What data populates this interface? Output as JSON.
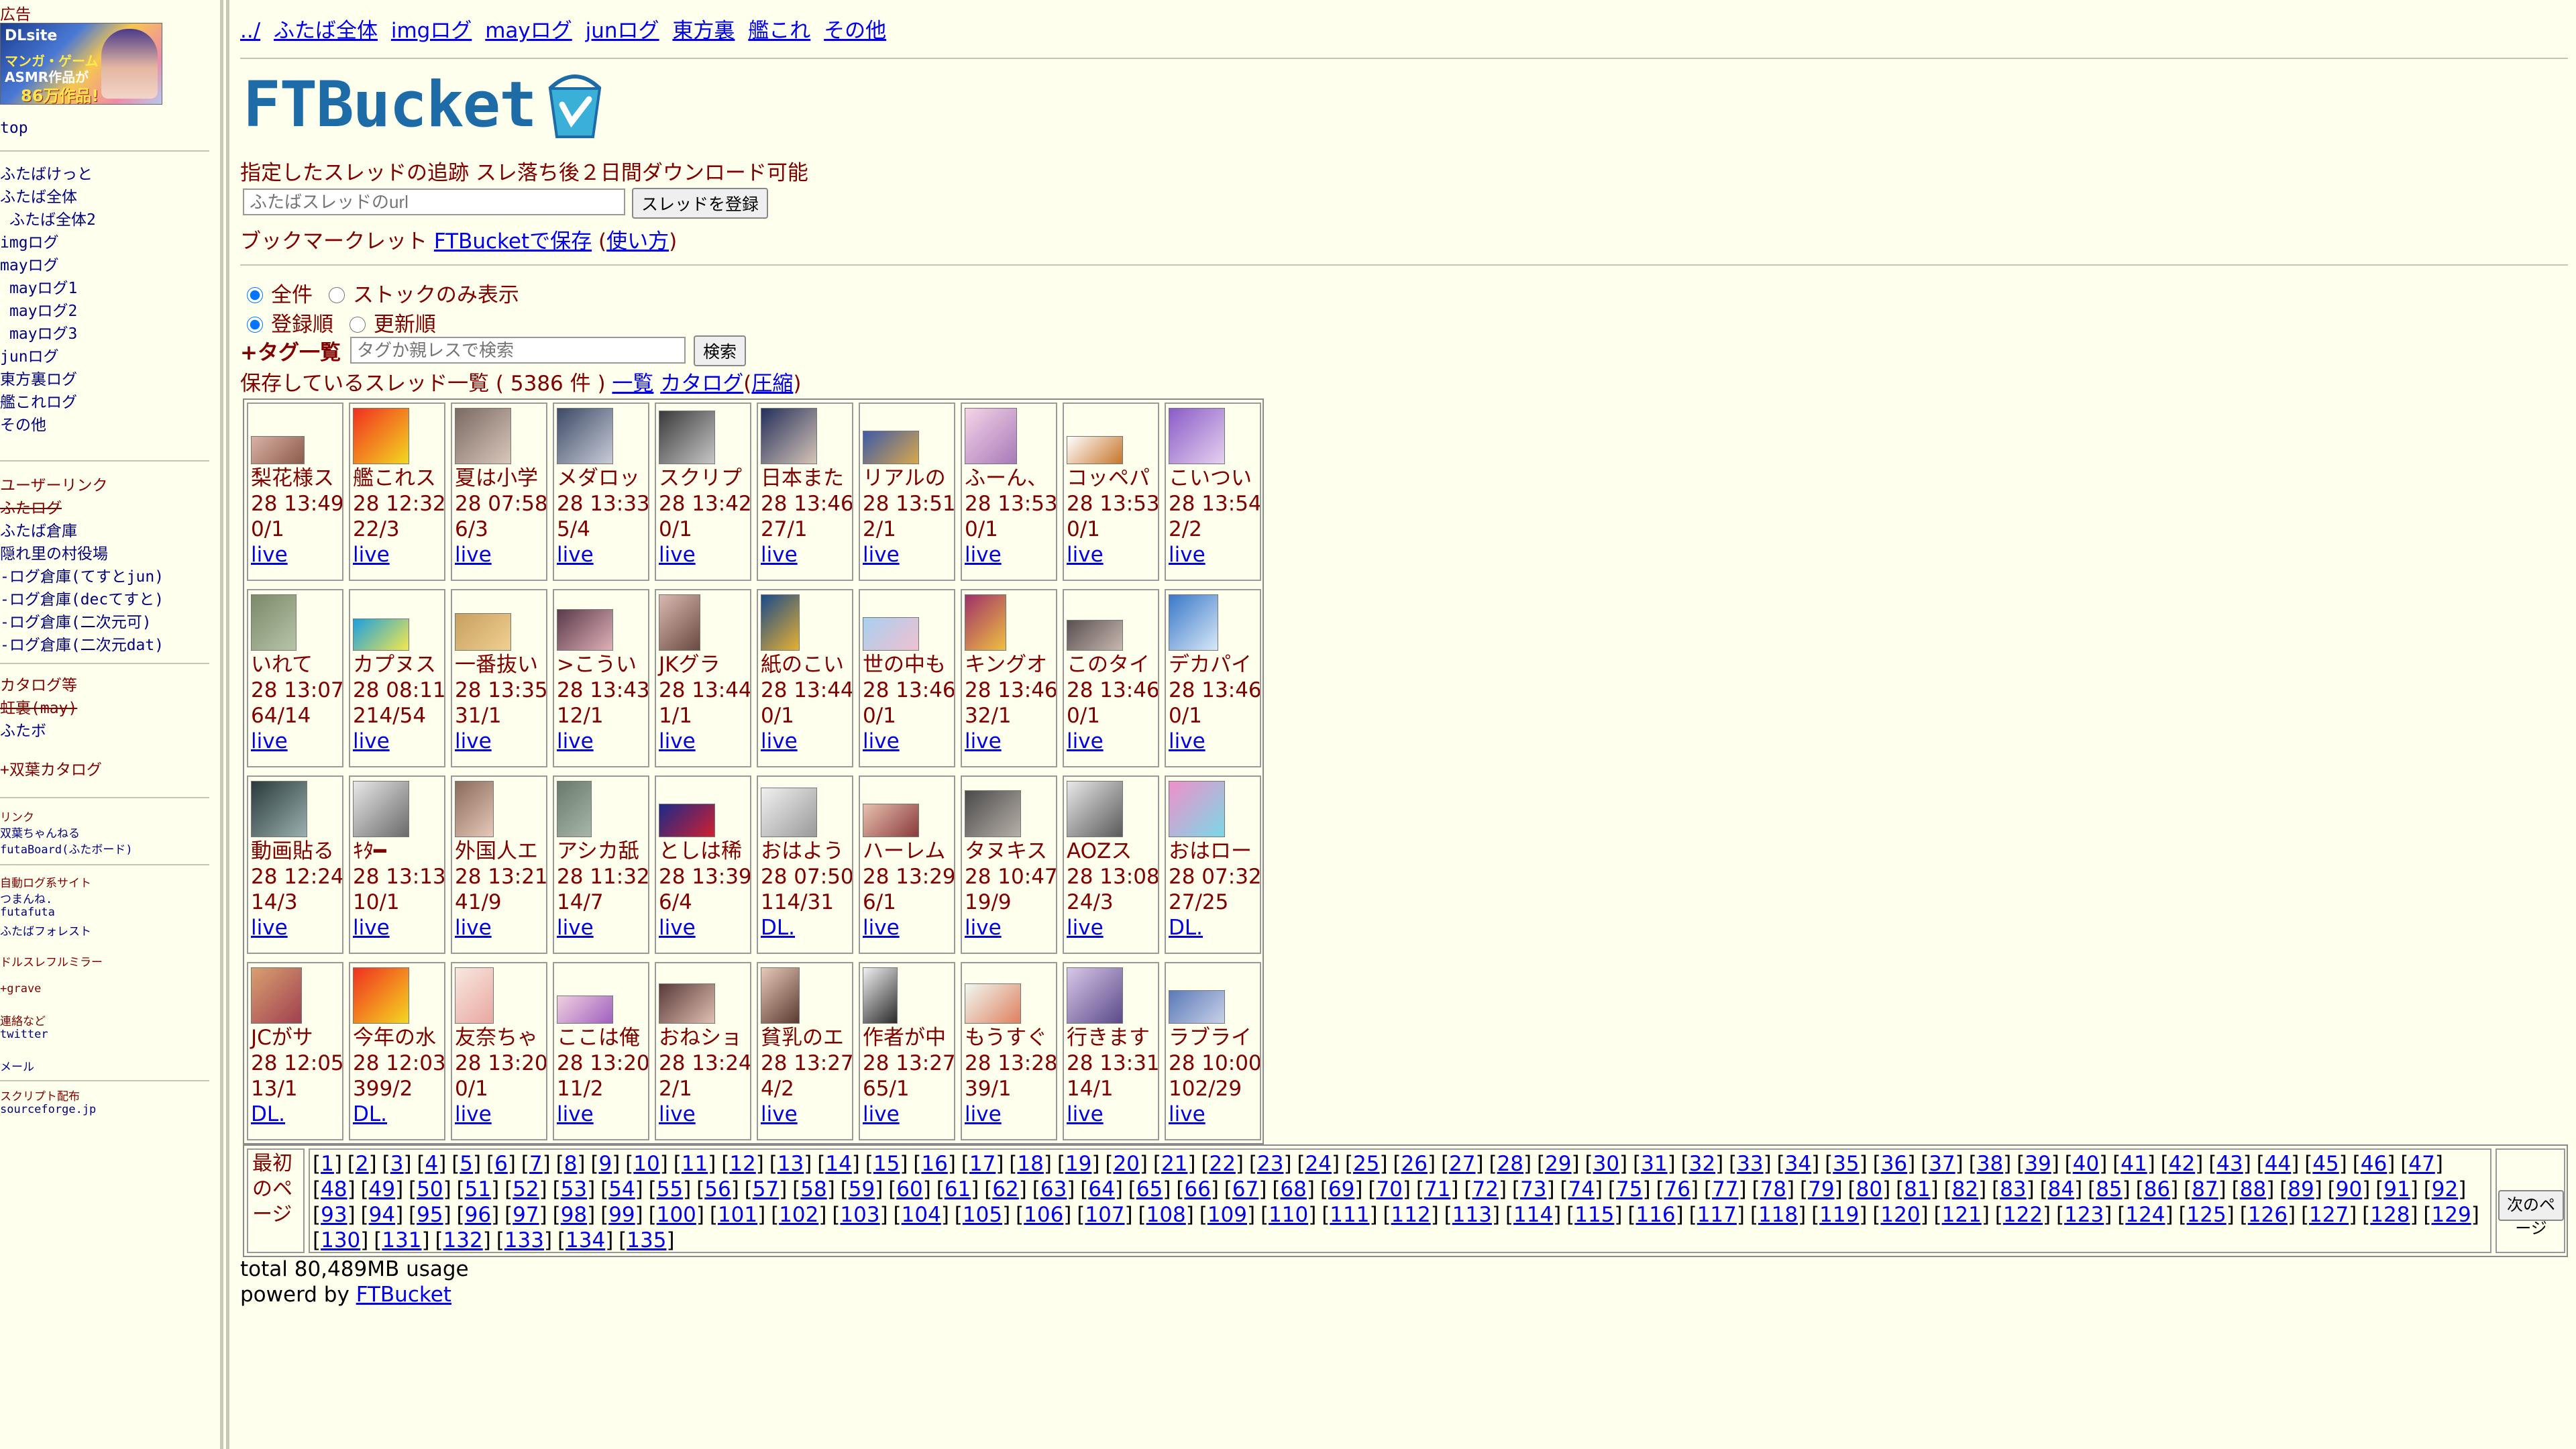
{
  "sidebar": {
    "ad_label": "広告",
    "ad_banner": {
      "line1": "DLsite",
      "line2": "マンガ・ゲーム",
      "line3": "ASMR作品が",
      "line4": "86万作品!"
    },
    "top": "top",
    "nav": [
      "ふたばけっと",
      "ふたば全体",
      "ふたば全体2",
      "imgログ",
      "mayログ",
      "mayログ1",
      "mayログ2",
      "mayログ3",
      "junログ",
      "東方裏ログ",
      "艦これログ",
      "その他"
    ],
    "user_links_title": "ユーザーリンク",
    "user_links": [
      "ふたログ",
      "ふたば倉庫",
      "隠れ里の村役場",
      "-ログ倉庫(てすとjun)",
      "-ログ倉庫(decてすと)",
      "-ログ倉庫(二次元可)",
      "-ログ倉庫(二次元dat)"
    ],
    "catalog_title": "カタログ等",
    "catalog_links": [
      "虹裏(may)",
      "ふたボ"
    ],
    "futaba_catalog": "+双葉カタログ",
    "link_title": "リンク",
    "links": [
      "双葉ちゃんねる",
      "futaBoard(ふたボード)"
    ],
    "auto_log_title": "自動ログ系サイト",
    "auto_log_links": [
      "つまんね.",
      "futafuta",
      "ふたばフォレスト"
    ],
    "mirror": "ドルスレフルミラー",
    "grave": "+grave",
    "contact_title": "連絡など",
    "twitter": "twitter",
    "mail": "メール",
    "script_title": "スクリプト配布",
    "sourceforge": "sourceforge.jp"
  },
  "topnav": [
    "../",
    "ふたば全体",
    "imgログ",
    "mayログ",
    "junログ",
    "東方裏",
    "艦これ",
    "その他"
  ],
  "logo_text": "FTBucket",
  "description": "指定したスレッドの追跡 スレ落ち後２日間ダウンロード可能",
  "url_input": {
    "placeholder": "ふたばスレッドのurl"
  },
  "register_button": "スレッドを登録",
  "bookmarklet": {
    "label": "ブックマークレット ",
    "link": "FTBucketで保存",
    "help": "使い方"
  },
  "filter": {
    "all": "全件",
    "stock_only": "ストックのみ表示",
    "by_registered": "登録順",
    "by_updated": "更新順"
  },
  "tag": {
    "label": "+タグ一覧",
    "placeholder": "タグか親レスで検索",
    "search_button": "検索"
  },
  "list_header": {
    "prefix": "保存しているスレッド一覧 ( 5386 件 ) ",
    "list_link": "一覧",
    "catalog_link": "カタログ",
    "compress_link": "圧縮"
  },
  "threads": [
    {
      "title": "梨花様ス",
      "time": "28 13:49",
      "counts": "0/1",
      "link": "live",
      "thumb": [
        "#d9b3a6",
        "#8c5a4a"
      ],
      "tw": 78,
      "th": 40
    },
    {
      "title": "艦これス",
      "time": "28 12:32",
      "counts": "22/3",
      "link": "live",
      "thumb": [
        "#f03020",
        "#f4d820"
      ],
      "tw": 82,
      "th": 82
    },
    {
      "title": "夏は小学",
      "time": "28 07:58",
      "counts": "6/3",
      "link": "live",
      "thumb": [
        "#7b6a63",
        "#d9c7bb"
      ],
      "tw": 82,
      "th": 82
    },
    {
      "title": "メダロッ",
      "time": "28 13:33",
      "counts": "5/4",
      "link": "live",
      "thumb": [
        "#3d4a66",
        "#c8ccd8"
      ],
      "tw": 82,
      "th": 82
    },
    {
      "title": "スクリプ",
      "time": "28 13:42",
      "counts": "0/1",
      "link": "live",
      "thumb": [
        "#3a3a3a",
        "#c6c6c6"
      ],
      "tw": 82,
      "th": 78
    },
    {
      "title": "日本また",
      "time": "28 13:46",
      "counts": "27/1",
      "link": "live",
      "thumb": [
        "#24305a",
        "#d6c4b8"
      ],
      "tw": 82,
      "th": 82
    },
    {
      "title": "リアルの",
      "time": "28 13:51",
      "counts": "2/1",
      "link": "live",
      "thumb": [
        "#3e5aa8",
        "#d8a84a"
      ],
      "tw": 82,
      "th": 48
    },
    {
      "title": "ふーん、",
      "time": "28 13:53",
      "counts": "0/1",
      "link": "live",
      "thumb": [
        "#f5d4e8",
        "#a87ab8"
      ],
      "tw": 76,
      "th": 82
    },
    {
      "title": "コッペパ",
      "time": "28 13:53",
      "counts": "0/1",
      "link": "live",
      "thumb": [
        "#ffffff",
        "#c8752a"
      ],
      "tw": 82,
      "th": 40
    },
    {
      "title": "こいつい",
      "time": "28 13:54",
      "counts": "2/2",
      "link": "live",
      "thumb": [
        "#8a5cc8",
        "#e6d0f0"
      ],
      "tw": 82,
      "th": 82
    },
    {
      "title": "いれて",
      "time": "28 13:07",
      "counts": "64/14",
      "link": "live",
      "thumb": [
        "#7a8a6a",
        "#b8c4a8"
      ],
      "tw": 66,
      "th": 82
    },
    {
      "title": "カプヌス",
      "time": "28 08:11",
      "counts": "214/54",
      "link": "live",
      "thumb": [
        "#1aa0e0",
        "#f4e84a"
      ],
      "tw": 82,
      "th": 46
    },
    {
      "title": "一番抜い",
      "time": "28 13:35",
      "counts": "31/1",
      "link": "live",
      "thumb": [
        "#c8a060",
        "#f0d090"
      ],
      "tw": 82,
      "th": 54
    },
    {
      "title": ">こうい",
      "time": "28 13:43",
      "counts": "12/1",
      "link": "live",
      "thumb": [
        "#5a3a4a",
        "#e0b0b8"
      ],
      "tw": 82,
      "th": 60
    },
    {
      "title": "JKグラ",
      "time": "28 13:44",
      "counts": "1/1",
      "link": "live",
      "thumb": [
        "#d8b8b0",
        "#6a4a40"
      ],
      "tw": 60,
      "th": 82
    },
    {
      "title": "紙のこい",
      "time": "28 13:44",
      "counts": "0/1",
      "link": "live",
      "thumb": [
        "#1a4a8a",
        "#e8b030"
      ],
      "tw": 56,
      "th": 82
    },
    {
      "title": "世の中も",
      "time": "28 13:46",
      "counts": "0/1",
      "link": "live",
      "thumb": [
        "#a8d0f0",
        "#f0c0d0"
      ],
      "tw": 82,
      "th": 48
    },
    {
      "title": "キングオ",
      "time": "28 13:46",
      "counts": "32/1",
      "link": "live",
      "thumb": [
        "#a0306a",
        "#f0c040"
      ],
      "tw": 60,
      "th": 82
    },
    {
      "title": "このタイ",
      "time": "28 13:46",
      "counts": "0/1",
      "link": "live",
      "thumb": [
        "#5a5050",
        "#c8b8b0"
      ],
      "tw": 82,
      "th": 44
    },
    {
      "title": "デカパイ",
      "time": "28 13:46",
      "counts": "0/1",
      "link": "live",
      "thumb": [
        "#3a78c8",
        "#d8e8f8"
      ],
      "tw": 72,
      "th": 82
    },
    {
      "title": "動画貼る",
      "time": "28 12:24",
      "counts": "14/3",
      "link": "live",
      "thumb": [
        "#2a3a3a",
        "#9ab0b0"
      ],
      "tw": 82,
      "th": 82
    },
    {
      "title": "ｷﾀ━",
      "time": "28 13:13",
      "counts": "10/1",
      "link": "live",
      "thumb": [
        "#e8e8e8",
        "#6a6a6a"
      ],
      "tw": 82,
      "th": 82
    },
    {
      "title": "外国人エ",
      "time": "28 13:21",
      "counts": "41/9",
      "link": "live",
      "thumb": [
        "#8a6a5a",
        "#e8c8b8"
      ],
      "tw": 56,
      "th": 82
    },
    {
      "title": "アシカ舐",
      "time": "28 11:32",
      "counts": "14/7",
      "link": "live",
      "thumb": [
        "#6a7a6a",
        "#a8b8a8"
      ],
      "tw": 50,
      "th": 82
    },
    {
      "title": "としは稀",
      "time": "28 13:39",
      "counts": "6/4",
      "link": "live",
      "thumb": [
        "#1a2a8a",
        "#d02030"
      ],
      "tw": 82,
      "th": 48
    },
    {
      "title": "おはよう",
      "time": "28 07:50",
      "counts": "114/31",
      "link": "DL.",
      "thumb": [
        "#f0f0f0",
        "#9a9a9a"
      ],
      "tw": 82,
      "th": 72
    },
    {
      "title": "ハーレム",
      "time": "28 13:29",
      "counts": "6/1",
      "link": "live",
      "thumb": [
        "#e8c0b0",
        "#8a3a3a"
      ],
      "tw": 82,
      "th": 48
    },
    {
      "title": "タヌキス",
      "time": "28 10:47",
      "counts": "19/9",
      "link": "live",
      "thumb": [
        "#4a4a4a",
        "#b8b0a8"
      ],
      "tw": 82,
      "th": 68
    },
    {
      "title": "AOZス",
      "time": "28 13:08",
      "counts": "24/3",
      "link": "live",
      "thumb": [
        "#e8e8e8",
        "#5a5a5a"
      ],
      "tw": 82,
      "th": 82
    },
    {
      "title": "おはロー",
      "time": "28 07:32",
      "counts": "27/25",
      "link": "DL.",
      "thumb": [
        "#f090c8",
        "#7ad8e8"
      ],
      "tw": 82,
      "th": 82
    },
    {
      "title": "JCがサ",
      "time": "28 12:05",
      "counts": "13/1",
      "link": "DL.",
      "thumb": [
        "#d8a070",
        "#a04050"
      ],
      "tw": 74,
      "th": 82
    },
    {
      "title": "今年の水",
      "time": "28 12:03",
      "counts": "399/2",
      "link": "DL.",
      "thumb": [
        "#f03020",
        "#f4d820"
      ],
      "tw": 82,
      "th": 82
    },
    {
      "title": "友奈ちゃ",
      "time": "28 13:20",
      "counts": "0/1",
      "link": "live",
      "thumb": [
        "#f8e8e0",
        "#e8a8a0"
      ],
      "tw": 56,
      "th": 82
    },
    {
      "title": "ここは俺",
      "time": "28 13:20",
      "counts": "11/2",
      "link": "live",
      "thumb": [
        "#f0d0e0",
        "#a060c0"
      ],
      "tw": 82,
      "th": 40
    },
    {
      "title": "おねショ",
      "time": "28 13:24",
      "counts": "2/1",
      "link": "live",
      "thumb": [
        "#5a3a3a",
        "#e0c0b0"
      ],
      "tw": 82,
      "th": 58
    },
    {
      "title": "貧乳のエ",
      "time": "28 13:27",
      "counts": "4/2",
      "link": "live",
      "thumb": [
        "#e8c8b8",
        "#5a3a30"
      ],
      "tw": 56,
      "th": 82
    },
    {
      "title": "作者が中",
      "time": "28 13:27",
      "counts": "65/1",
      "link": "live",
      "thumb": [
        "#f0f0f0",
        "#2a2a2a"
      ],
      "tw": 50,
      "th": 82
    },
    {
      "title": "もうすぐ",
      "time": "28 13:28",
      "counts": "39/1",
      "link": "live",
      "thumb": [
        "#f0f8f0",
        "#e08060"
      ],
      "tw": 82,
      "th": 58
    },
    {
      "title": "行きます",
      "time": "28 13:31",
      "counts": "14/1",
      "link": "live",
      "thumb": [
        "#d8c8e8",
        "#5a4a8a"
      ],
      "tw": 82,
      "th": 82
    },
    {
      "title": "ラブライ",
      "time": "28 10:00",
      "counts": "102/29",
      "link": "live",
      "thumb": [
        "#5a7ab8",
        "#c8d0e8"
      ],
      "tw": 82,
      "th": 48
    }
  ],
  "pager": {
    "first": "最初のページ",
    "next": "次のページ",
    "page_count": 135
  },
  "usage": "total 80,489MB usage",
  "powered": {
    "prefix": "powerd by ",
    "link": "FTBucket"
  }
}
